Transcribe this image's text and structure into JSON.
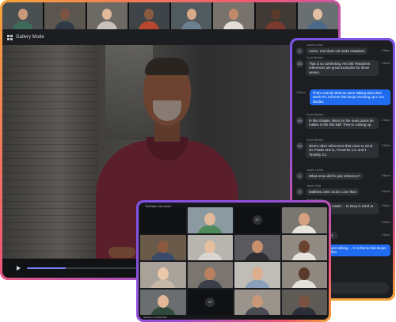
{
  "colors": {
    "accent_blue": "#1f6cf0",
    "frame_orange": "#f3a43a",
    "frame_pink": "#ef5a72",
    "frame_purple": "#9a4fd8",
    "dark_bg": "#18191c"
  },
  "main_window": {
    "mode_label": "Gallery Mode",
    "mode_icon": "grid-icon",
    "thumbnails": [
      {
        "skin": "#c89a7a",
        "shirt": "#3d6b5a",
        "bg": "#4a4f52"
      },
      {
        "skin": "#7a5440",
        "shirt": "#2f3a48",
        "bg": "#5b5650"
      },
      {
        "skin": "#e0b89a",
        "shirt": "#c7c2bb",
        "bg": "#6d6a66"
      },
      {
        "skin": "#8a5a40",
        "shirt": "#b8472e",
        "bg": "#3e4448"
      },
      {
        "skin": "#d8aa8a",
        "shirt": "#6b7f90",
        "bg": "#515a5f"
      },
      {
        "skin": "#c08a6a",
        "shirt": "#e2ded8",
        "bg": "#77726b"
      },
      {
        "skin": "#5a3a2a",
        "shirt": "#7a3a2e",
        "bg": "#3f3a36"
      },
      {
        "skin": "#e4c0a0",
        "shirt": "#4b6a8a",
        "bg": "#6a6f72"
      }
    ],
    "video_progress": 0.35
  },
  "chat": {
    "messages": [
      {
        "name": "Jackie Lomar",
        "avatar": "JL",
        "text": "Amen. God does not make mistakes!",
        "time": "2:56pm",
        "mine": false
      },
      {
        "name": "Scott Westley",
        "avatar": "SW",
        "text": "That is so comforting. His Old Testament references are great examples for these verses.",
        "time": "2:56pm",
        "mine": false
      },
      {
        "name": "",
        "avatar": "",
        "text": "That's exactly what we were talking about last week! It's a theme that keeps showing up in our studies.",
        "time": "2:56pm",
        "mine": true
      },
      {
        "name": "Scott Westley",
        "avatar": "SW",
        "text": "In this chapter, listen for the main points he makes in the first half. They're coming up.",
        "time": "2:56pm",
        "mine": false
      },
      {
        "name": "Scott Westley",
        "avatar": "SW",
        "text": "Here's other references that come to mind on: Psalm 119:11, Proverbs 1:3, and 1 Timothy 3:1",
        "time": "2:56pm",
        "mine": false
      },
      {
        "name": "Jackie Lomar",
        "avatar": "JL",
        "text": "What verse did he just reference?",
        "time": "2:56pm",
        "mine": false
      },
      {
        "name": "Jason Stolz",
        "avatar": "JS",
        "text": "Matthew John 16:33. Love that!",
        "time": "2:56pm",
        "mine": false
      },
      {
        "name": "Scott Westley",
        "avatar": "SW",
        "text": "... point he just made! ... to keep in mind at the ... g.",
        "time": "2:56pm",
        "mine": false
      },
      {
        "name": "",
        "avatar": "",
        "text": "... reminder.",
        "time": "2:56pm",
        "mine": false
      },
      {
        "name": "",
        "avatar": "",
        "text": "... to main in chapter 4.",
        "time": "2:56pm",
        "mine": false
      },
      {
        "name": "",
        "avatar": "",
        "text": "... what we were talking ... t's a theme that keeps ... in our studies.",
        "time": "2:56pm",
        "mine": true
      }
    ]
  },
  "gallery": {
    "top_label": "TheFalker has joined",
    "bottom_label": "Session in Studio 02:3",
    "tiles": [
      {
        "type": "empty"
      },
      {
        "type": "person",
        "skin": "#e0b89a",
        "shirt": "#4f8a5a",
        "bg": "#8a9aa0"
      },
      {
        "type": "muted",
        "initials": "SC"
      },
      {
        "type": "person",
        "skin": "#d4a080",
        "shirt": "#e8e4de",
        "bg": "#7a7670"
      },
      {
        "type": "person",
        "skin": "#8a5a40",
        "shirt": "#3a4a6a",
        "bg": "#6a5a4a"
      },
      {
        "type": "person",
        "skin": "#e4c0a0",
        "shirt": "#d8d4ce",
        "bg": "#b8b4ae"
      },
      {
        "type": "person",
        "skin": "#c8906a",
        "shirt": "#2e2e34",
        "bg": "#5a5a5e"
      },
      {
        "type": "person",
        "skin": "#6a4430",
        "shirt": "#e6e2dc",
        "bg": "#908a82"
      },
      {
        "type": "person",
        "skin": "#e8c8a8",
        "shirt": "#c8b8a8",
        "bg": "#a8a29a"
      },
      {
        "type": "person",
        "skin": "#b88060",
        "shirt": "#3a3e48",
        "bg": "#7a756e"
      },
      {
        "type": "person",
        "skin": "#dcae8e",
        "shirt": "#8aa0b8",
        "bg": "#c0bcb6"
      },
      {
        "type": "person",
        "skin": "#5a3a2a",
        "shirt": "#e4e0da",
        "bg": "#8e8880"
      },
      {
        "type": "person",
        "skin": "#e2b898",
        "shirt": "#2f4a3a",
        "bg": "#6a6e70"
      },
      {
        "type": "muted",
        "initials": "CE"
      },
      {
        "type": "person",
        "skin": "#c89878",
        "shirt": "#4a4a52",
        "bg": "#9a948c"
      },
      {
        "type": "person",
        "skin": "#7a5240",
        "shirt": "#2a2e38",
        "bg": "#5e5a56"
      }
    ]
  }
}
